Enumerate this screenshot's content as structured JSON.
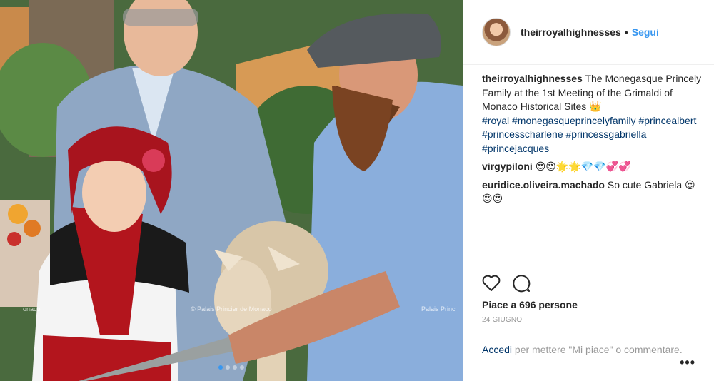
{
  "post": {
    "username": "theirroyalhighnesses",
    "follow_label": "Segui",
    "dot": "•",
    "watermark": "© Palais Princier de Monaco",
    "watermark_left": "onaco",
    "watermark_right": "Palais Princ",
    "caption": {
      "user": "theirroyalhighnesses",
      "text": "The Monegasque Princely Family at the 1st Meeting of the Grimaldi of Monaco Historical Sites 👑",
      "hashtags": "#royal #monegasqueprincelyfamily #princealbert #princesscharlene #princessgabriella #princejacques"
    },
    "comments": [
      {
        "user": "virgypiloni",
        "text": "😍😍🌟🌟💎💎💞💞"
      },
      {
        "user": "euridice.oliveira.machado",
        "text": "So cute Gabriela 😍😍😍"
      }
    ],
    "likes_text": "Piace a 696 persone",
    "date": "24 GIUGNO",
    "login_link": "Accedi",
    "login_text": "per mettere \"Mi piace\" o commentare.",
    "more_label": "•••",
    "carousel": {
      "count": 4,
      "active": 0
    }
  }
}
